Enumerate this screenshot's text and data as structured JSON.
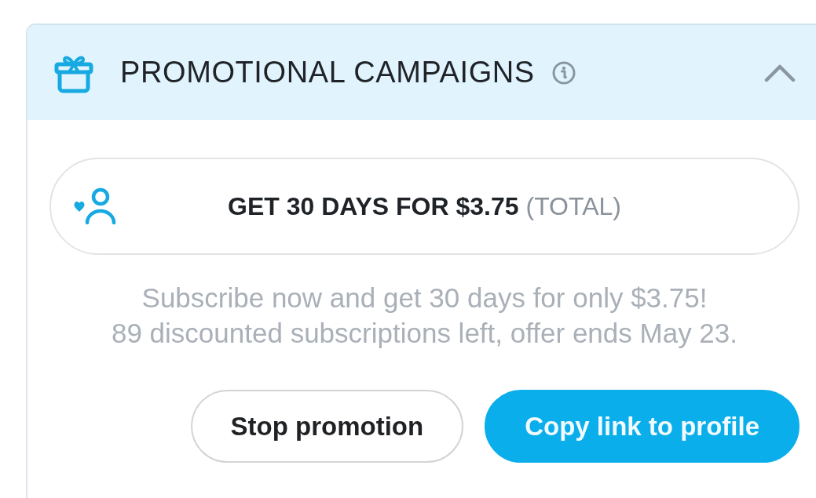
{
  "panel": {
    "title": "PROMOTIONAL CAMPAIGNS",
    "expanded": true
  },
  "offer": {
    "headline": "GET 30 DAYS FOR $3.75",
    "qualifier": "(TOTAL)"
  },
  "description": [
    "Subscribe now and get 30 days for only $3.75!",
    "89 discounted subscriptions left, offer ends May 23."
  ],
  "buttons": [
    {
      "label": "Stop promotion",
      "kind": "secondary"
    },
    {
      "label": "Copy link to profile",
      "kind": "primary"
    }
  ]
}
